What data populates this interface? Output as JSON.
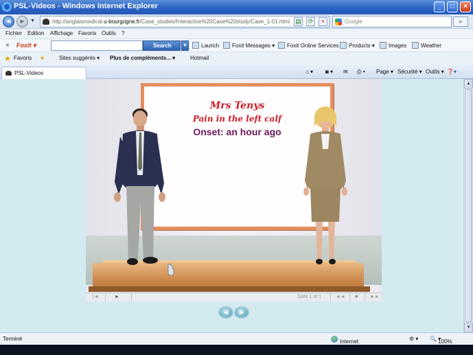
{
  "window": {
    "title": "PSL-Videos - Windows Internet Explorer",
    "buttons": {
      "minimize": "_",
      "maximize": "□",
      "close": "×"
    }
  },
  "address": {
    "back": "◄",
    "forward": "►",
    "url_prefix": "http://anglaismedical.",
    "url_domain": "u-bourgogne.fr",
    "url_path": "/Case_studies/Interactive%20Case%20study/Case_1-01.html",
    "search_placeholder": "Google",
    "search_go": "⌕"
  },
  "menu": [
    "Fichier",
    "Edition",
    "Affichage",
    "Favoris",
    "Outils",
    "?"
  ],
  "foxit_toolbar": {
    "close": "×",
    "logo": "Foxit ▾",
    "search_label": "Search",
    "search_value": "",
    "items": [
      "Launch",
      "Foxit Messages ▾",
      "Foxit Online Services",
      "Products ▾",
      "Images",
      "Weather"
    ]
  },
  "favorites_bar": {
    "favorites_label": "Favoris",
    "items": [
      "Sites suggérés ▾",
      "Plus de compléments... ▾",
      "Hotmail"
    ]
  },
  "tabs": {
    "active_tab": "PSL-Videos",
    "commands": [
      "Page ▾",
      "Sécurité ▾",
      "Outils ▾"
    ]
  },
  "slide": {
    "patient_name": "Mrs Tenys",
    "complaint": "Pain in the left calf",
    "onset": "Onset: an hour ago"
  },
  "player_controls": {
    "first": "|◄",
    "play": "►",
    "slide_label": "Slide 1 of 1",
    "prev": "◄◄",
    "stop": "■",
    "next": "►►"
  },
  "page_nav": {
    "prev": "◄",
    "next": "►"
  },
  "status": {
    "left": "Terminé",
    "zone": "Internet",
    "zoom": "100%"
  }
}
